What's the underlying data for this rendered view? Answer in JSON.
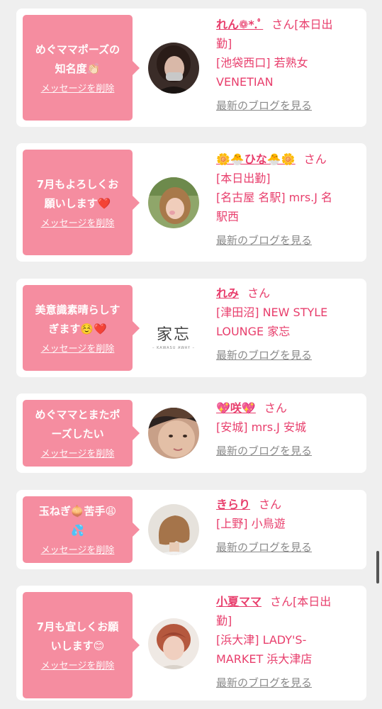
{
  "colors": {
    "accent": "#e83e6c",
    "bubble": "#f58da0",
    "background": "#efefef",
    "card": "#ffffff",
    "link_gray": "#8a8a8a"
  },
  "delete_label": "メッセージを削除",
  "blog_label": "最新のブログを見る",
  "san_label": "さん",
  "cards": [
    {
      "message_lines": [
        "めぐママポーズの",
        "知名度👏🏻"
      ],
      "name": "れん❁*.ﾟ",
      "info_lines": [
        "勤]",
        "[池袋西口] 若熟女",
        "VENETIAN"
      ],
      "first_line_suffix": "[本日出",
      "avatar_icon": "woman-portrait-icon"
    },
    {
      "message_lines": [
        "7月もよろしくお",
        "願いします❤️"
      ],
      "name": "🌼🐣ひな🐣🌼",
      "info_lines": [
        "[本日出勤]",
        "[名古屋 名駅] mrs.J 名",
        "駅西"
      ],
      "first_line_suffix": "",
      "avatar_icon": "woman-outdoor-portrait-icon"
    },
    {
      "message_lines": [
        "美意識素晴らしす",
        "ぎます☺️❤️"
      ],
      "name": "れみ",
      "info_lines": [
        "[津田沼] NEW STYLE",
        "LOUNGE 家忘"
      ],
      "first_line_suffix": "",
      "avatar_icon": "shop-logo-icon",
      "logo_text": "家忘",
      "logo_sub": "– KAWASU AWAY –"
    },
    {
      "message_lines": [
        "めぐママとまたポ",
        "ーズしたい"
      ],
      "name": "💖咲💖",
      "info_lines": [
        "[安城] mrs.J 安城"
      ],
      "first_line_suffix": "",
      "avatar_icon": "woman-closeup-icon"
    },
    {
      "message_lines": [
        "玉ねぎ🧅苦手😩",
        "💦"
      ],
      "name": "きらり",
      "info_lines": [
        "[上野] 小鳥遊"
      ],
      "first_line_suffix": "",
      "avatar_icon": "bob-hair-back-icon"
    },
    {
      "message_lines": [
        "7月も宜しくお願",
        "いします😊"
      ],
      "name": "小夏ママ",
      "info_lines": [
        "勤]",
        "[浜大津] LADY'S-",
        "MARKET 浜大津店"
      ],
      "first_line_suffix": "[本日出",
      "avatar_icon": "short-red-hair-icon"
    }
  ]
}
